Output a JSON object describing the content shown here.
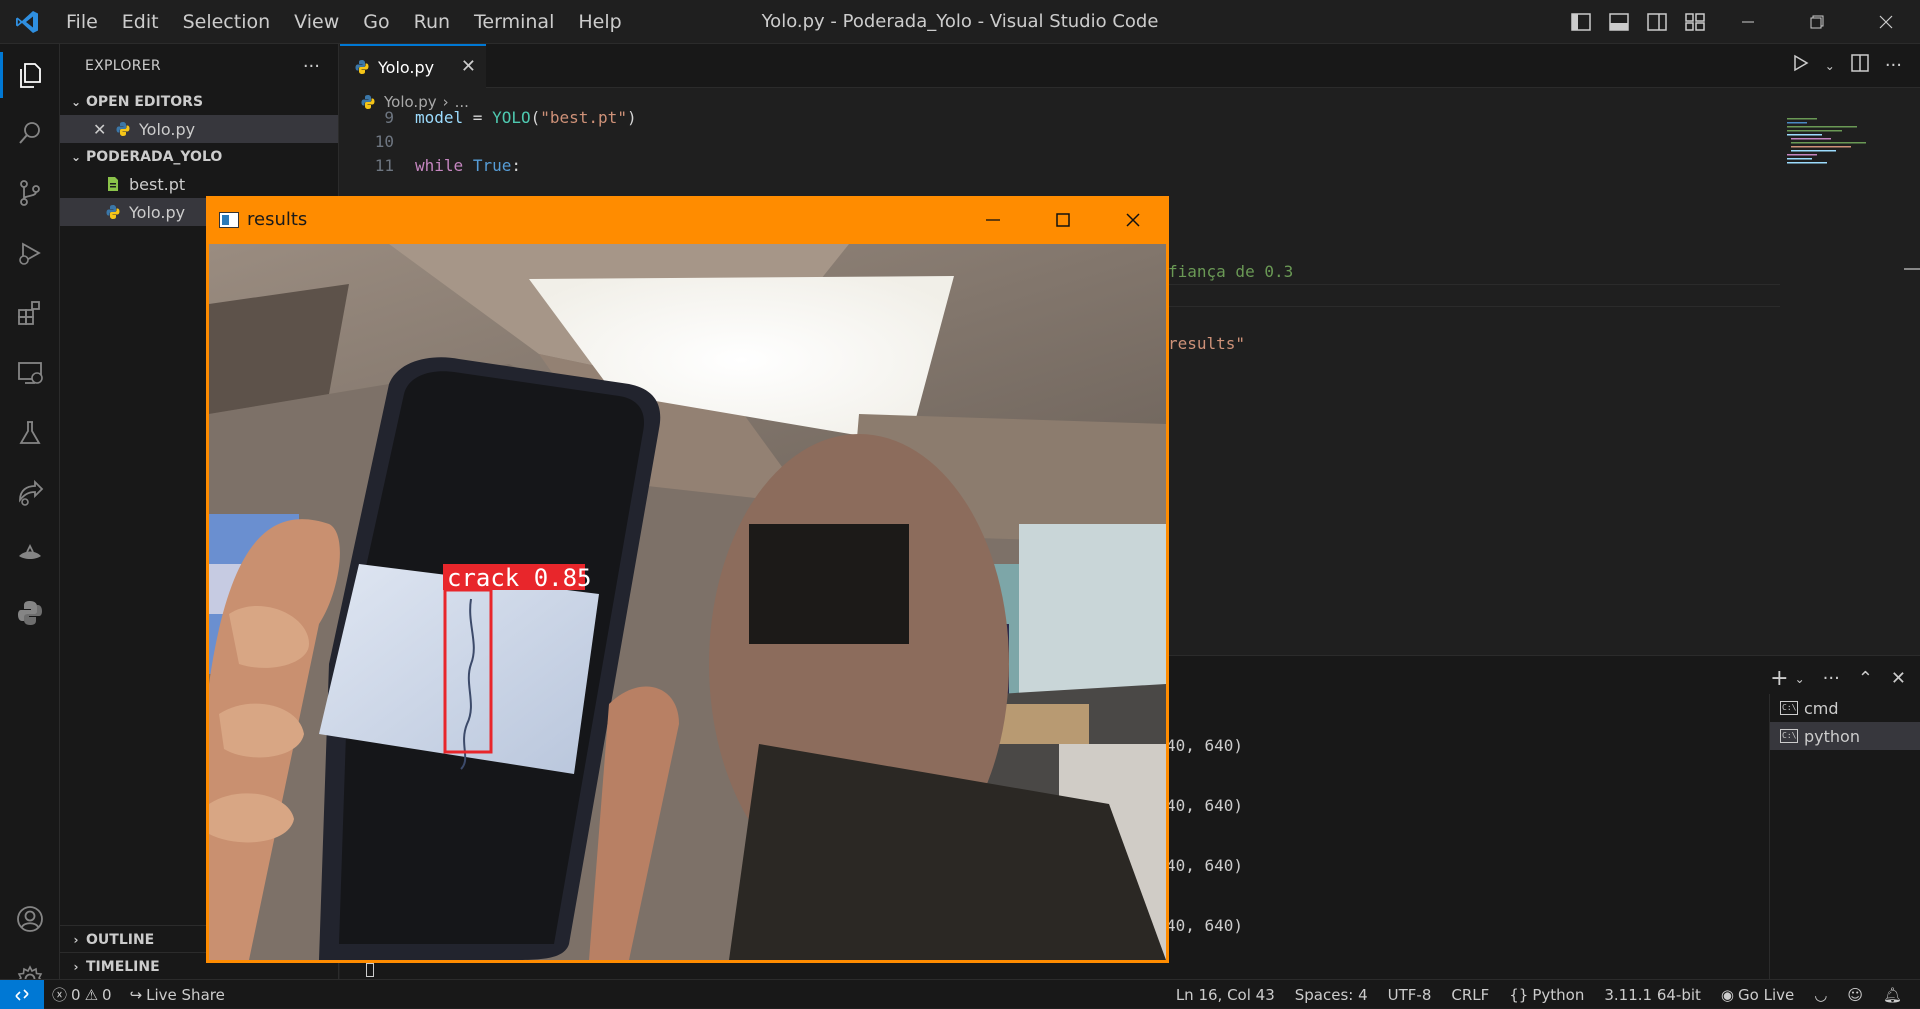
{
  "titlebar": {
    "menu": [
      "File",
      "Edit",
      "Selection",
      "View",
      "Go",
      "Run",
      "Terminal",
      "Help"
    ],
    "window_title": "Yolo.py - Poderada_Yolo - Visual Studio Code"
  },
  "activity_bar": [
    "explorer-icon",
    "search-icon",
    "source-control-icon",
    "run-debug-icon",
    "extensions-icon",
    "remote-explorer-icon",
    "testing-icon",
    "live-share-icon",
    "jupyter-icon",
    "python-icon",
    "accounts-icon",
    "settings-icon"
  ],
  "sidebar": {
    "title": "EXPLORER",
    "more": "···",
    "open_editors": {
      "title": "OPEN EDITORS",
      "items": [
        {
          "name": "Yolo.py"
        }
      ]
    },
    "folder": {
      "title": "PODERADA_YOLO",
      "items": [
        {
          "name": "best.pt"
        },
        {
          "name": "Yolo.py"
        }
      ]
    },
    "outline": "OUTLINE",
    "timeline": "TIMELINE"
  },
  "editor": {
    "tab": "Yolo.py",
    "breadcrumb": {
      "file": "Yolo.py",
      "rest": "..."
    },
    "lines": [
      {
        "num": "9",
        "tokens": [
          [
            "var",
            "model"
          ],
          [
            "plain",
            " = "
          ],
          [
            "fn",
            "YOLO"
          ],
          [
            "plain",
            "("
          ],
          [
            "str",
            "\"best.pt\""
          ],
          [
            "plain",
            ")"
          ]
        ]
      },
      {
        "num": "10",
        "tokens": []
      },
      {
        "num": "11",
        "tokens": [
          [
            "kw-ctrl",
            "while"
          ],
          [
            "plain",
            " "
          ],
          [
            "kw",
            "True"
          ],
          [
            "plain",
            ":"
          ]
        ]
      }
    ],
    "visible_fragments": {
      "comment": "fiança de 0.3",
      "string": "results\""
    }
  },
  "panel": {
    "terminal_lines": [
      "40, 640)",
      "40, 640)",
      "40, 640)",
      "40, 640)"
    ],
    "terminals": [
      {
        "name": "cmd",
        "selected": false
      },
      {
        "name": "python",
        "selected": true
      }
    ]
  },
  "statusbar": {
    "errors": "0",
    "warnings": "0",
    "live_share": "Live Share",
    "position": "Ln 16, Col 43",
    "spaces": "Spaces: 4",
    "encoding": "UTF-8",
    "eol": "CRLF",
    "language": "Python",
    "interpreter": "3.11.1 64-bit",
    "go_live": "Go Live"
  },
  "results_window": {
    "title": "results",
    "detection_label": "crack 0.85"
  },
  "colors": {
    "accent": "#0078d4",
    "results_titlebar": "#ff8c00",
    "detection_box": "#e8262b"
  }
}
